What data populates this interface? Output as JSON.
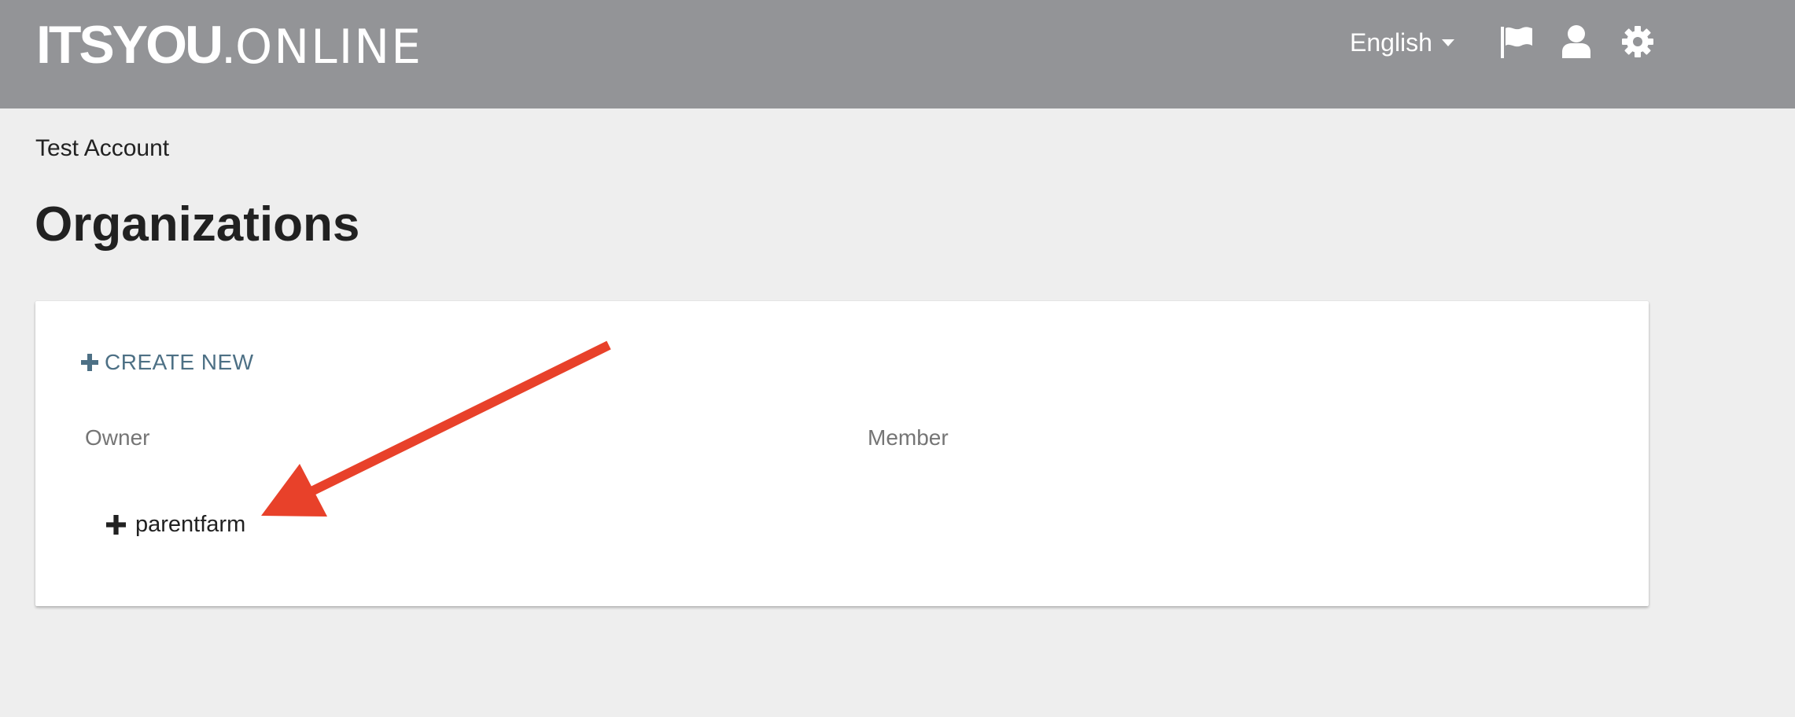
{
  "header": {
    "logo_bold": "ITSYOU",
    "logo_dot": ".",
    "logo_thin": "ONLINE",
    "language": "English",
    "icons": [
      "flag-icon",
      "user-icon",
      "gear-icon"
    ]
  },
  "account_name": "Test Account",
  "page_title": "Organizations",
  "organizations": {
    "create_new_label": "CREATE NEW",
    "owner_header": "Owner",
    "member_header": "Member",
    "owner_items": [
      {
        "name": "parentfarm"
      }
    ]
  },
  "colors": {
    "topbar": "#939497",
    "background": "#eeeeee",
    "accent_link": "#4d7085",
    "annotation_arrow": "#e8412a"
  }
}
